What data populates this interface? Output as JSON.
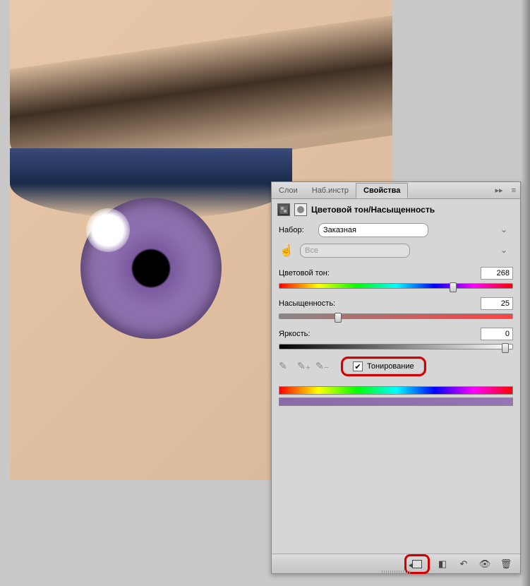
{
  "tabs": {
    "layers": "Слои",
    "presets": "Наб.инстр",
    "properties": "Свойства"
  },
  "panel": {
    "title": "Цветовой тон/Насыщенность"
  },
  "preset": {
    "label": "Набор:",
    "value": "Заказная"
  },
  "range": {
    "value": "Все"
  },
  "sliders": {
    "hue": {
      "label": "Цветовой тон:",
      "value": "268",
      "pos": 74.4
    },
    "saturation": {
      "label": "Насыщенность:",
      "value": "25",
      "pos": 25
    },
    "lightness": {
      "label": "Яркость:",
      "value": "0",
      "pos": 97
    }
  },
  "colorize": {
    "label": "Тонирование",
    "checked": "✔"
  }
}
